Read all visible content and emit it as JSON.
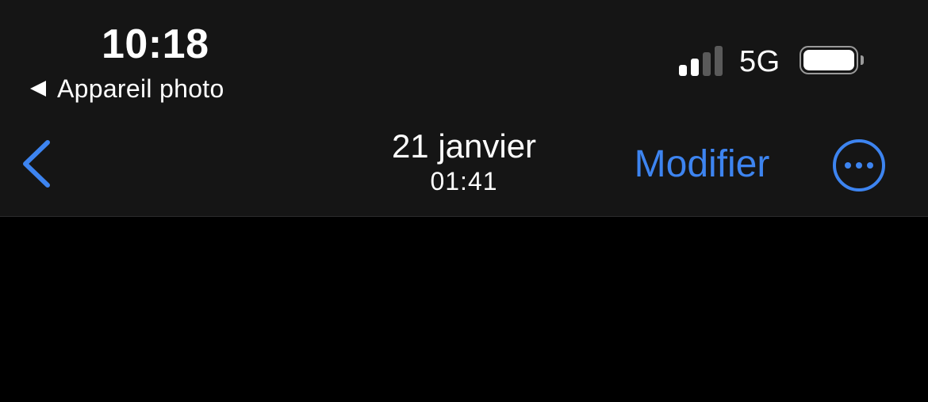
{
  "status_bar": {
    "time": "10:18",
    "back_app_label": "Appareil photo",
    "network": "5G",
    "signal_bars_active": 2,
    "signal_bars_total": 4,
    "battery_level": 1.0
  },
  "nav_bar": {
    "title_date": "21 janvier",
    "title_time": "01:41",
    "edit_label": "Modifier",
    "back_icon": "chevron-left-icon",
    "more_icon": "ellipsis-circle-icon"
  },
  "colors": {
    "accent": "#3d84f0",
    "bar_background": "#151515",
    "content_background": "#000000",
    "text": "#ffffff",
    "inactive_signal": "#5a5a5a"
  }
}
